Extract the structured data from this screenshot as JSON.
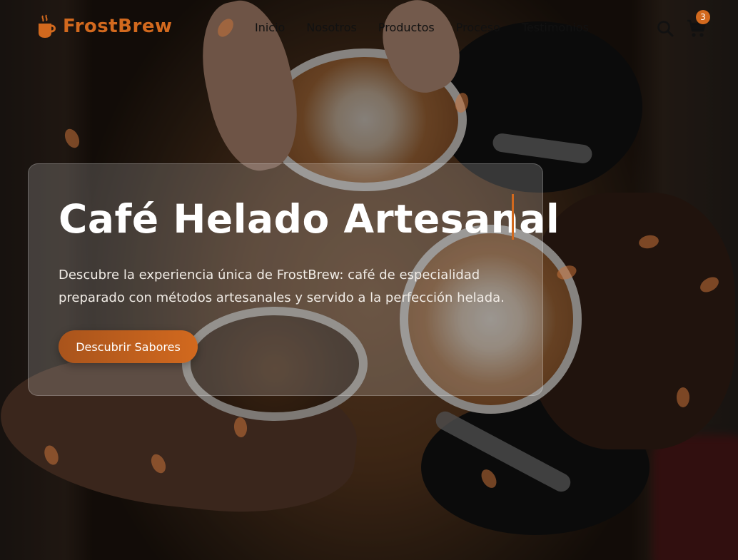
{
  "brand": {
    "name": "FrostBrew",
    "accent_color": "#d2691e"
  },
  "nav": {
    "items": [
      {
        "label": "Inicio"
      },
      {
        "label": "Nosotros"
      },
      {
        "label": "Productos"
      },
      {
        "label": "Proceso"
      },
      {
        "label": "Testimonios"
      }
    ]
  },
  "header_icons": {
    "search": "search-icon",
    "cart": "cart-icon",
    "cart_count": "3"
  },
  "hero": {
    "title": "Café Helado Artesanal",
    "description": "Descubre la experiencia única de FrostBrew: café de especialidad preparado con métodos artesanales y servido a la perfección helada.",
    "cta_label": "Descubrir Sabores"
  }
}
